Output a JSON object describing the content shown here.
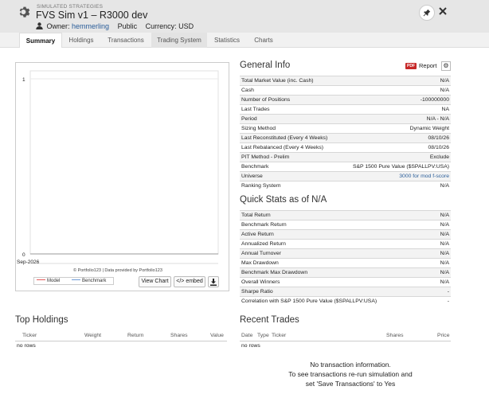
{
  "header": {
    "label": "SIMULATED STRATEGIES",
    "title": "FVS Sim v1 – R3000 dev",
    "owner_label": "Owner:",
    "owner": "hemmerling",
    "visibility": "Public",
    "currency": "Currency: USD"
  },
  "tabs": [
    "Summary",
    "Holdings",
    "Transactions",
    "Trading System",
    "Statistics",
    "Charts"
  ],
  "chart": {
    "y_top": "1",
    "y_bottom": "0",
    "x_label": "Sep-2026",
    "credit": "© Portfolio123 | Data provided by Portfolio123",
    "legend": [
      "Model",
      "Benchmark"
    ],
    "model_color": "#e35a5a",
    "benchmark_color": "#6e9bd6",
    "view_chart": "View Chart",
    "embed": "</> embed"
  },
  "chart_data": {
    "type": "line",
    "x": [
      "Sep-2026"
    ],
    "ylim": [
      0,
      1
    ],
    "series": [
      {
        "name": "Model",
        "values": []
      },
      {
        "name": "Benchmark",
        "values": []
      }
    ],
    "legend": "bottom-left",
    "grid": true
  },
  "general_info": {
    "title": "General Info",
    "pdf": "PDF",
    "report": "Report",
    "rows": [
      {
        "k": "Total Market Value (inc. Cash)",
        "v": "N/A"
      },
      {
        "k": "Cash",
        "v": "N/A"
      },
      {
        "k": "Number of Positions",
        "v": "-100000000"
      },
      {
        "k": "Last Trades",
        "v": "NA"
      },
      {
        "k": "Period",
        "v": "N/A - N/A"
      },
      {
        "k": "Sizing Method",
        "v": "Dynamic Weight"
      },
      {
        "k": "Last Reconstituted (Every 4 Weeks)",
        "v": "08/10/26"
      },
      {
        "k": "Last Rebalanced (Every 4 Weeks)",
        "v": "08/10/26"
      },
      {
        "k": "PIT Method - Prelim",
        "v": "Exclude"
      },
      {
        "k": "Benchmark",
        "v": "S&P 1500 Pure Value ($SPALLPV:USA)"
      },
      {
        "k": "Universe",
        "v": "3000 for mod f-score",
        "link": true
      },
      {
        "k": "Ranking System",
        "v": "N/A"
      }
    ]
  },
  "quick_stats": {
    "title": "Quick Stats as of N/A",
    "rows": [
      {
        "k": "Total Return",
        "v": "N/A"
      },
      {
        "k": "Benchmark Return",
        "v": "N/A"
      },
      {
        "k": "Active Return",
        "v": "N/A"
      },
      {
        "k": "Annualized Return",
        "v": "N/A"
      },
      {
        "k": "Annual Turnover",
        "v": "N/A"
      },
      {
        "k": "Max Drawdown",
        "v": "N/A"
      },
      {
        "k": "Benchmark Max Drawdown",
        "v": "N/A"
      },
      {
        "k": "Overall Winners",
        "v": "N/A"
      },
      {
        "k": "Sharpe Ratio",
        "v": "-"
      },
      {
        "k": "Correlation with S&P 1500 Pure Value ($SPALLPV:USA)",
        "v": "-"
      }
    ]
  },
  "top_holdings": {
    "title": "Top Holdings",
    "columns": [
      "Ticker",
      "Weight",
      "Return",
      "Shares",
      "Value"
    ],
    "empty": "no rows"
  },
  "recent_trades": {
    "title": "Recent Trades",
    "columns": [
      "Date",
      "Type",
      "Ticker",
      "Shares",
      "Price"
    ],
    "empty": "no rows",
    "message_1": "No transaction information.",
    "message_2": "To see transactions re-run simulation and",
    "message_3": "set 'Save Transactions' to Yes"
  }
}
